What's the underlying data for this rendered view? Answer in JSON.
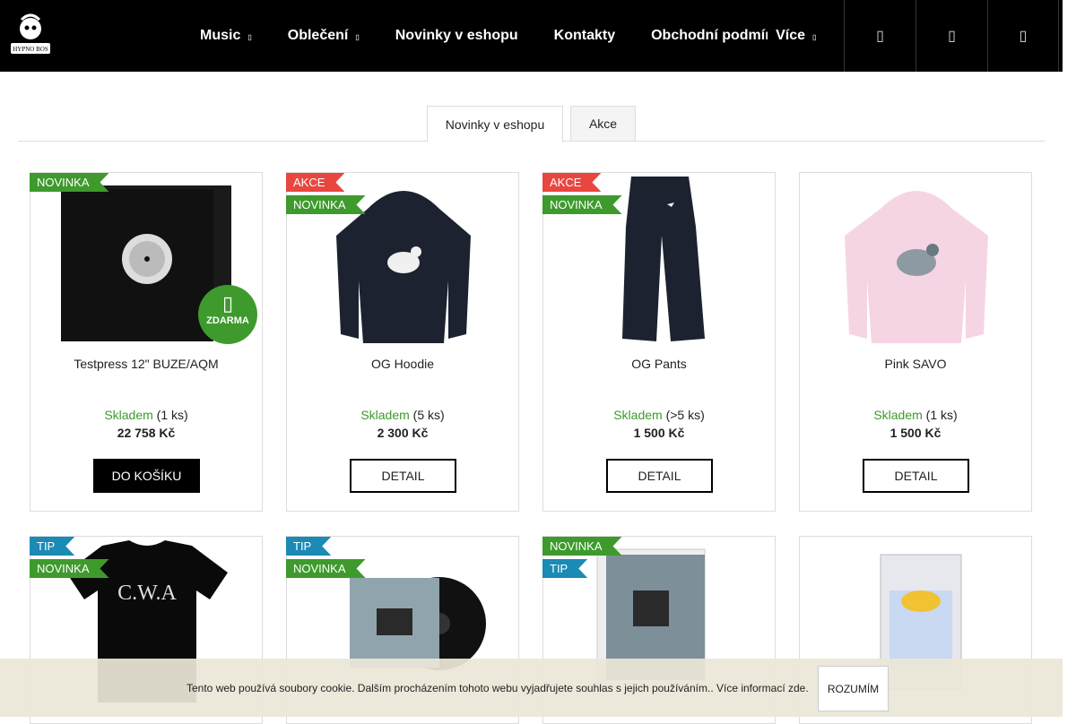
{
  "header": {
    "logo_text": "HYPNO BOS",
    "nav": [
      {
        "label": "Music",
        "has_dropdown": true
      },
      {
        "label": "Oblečení",
        "has_dropdown": true
      },
      {
        "label": "Novinky v eshopu",
        "has_dropdown": false
      },
      {
        "label": "Kontakty",
        "has_dropdown": false
      },
      {
        "label": "Obchodní podmínky",
        "has_dropdown": false
      },
      {
        "label": "Více",
        "has_dropdown": true
      }
    ],
    "icons": [
      "search-icon",
      "user-icon",
      "cart-icon"
    ]
  },
  "tabs": [
    {
      "label": "Novinky v eshopu",
      "active": true
    },
    {
      "label": "Akce",
      "active": false
    }
  ],
  "products": [
    {
      "name": "Testpress 12\" BUZE/AQM",
      "flags": [
        "NOVINKA"
      ],
      "stock_label": "Skladem",
      "stock_qty": "(1 ks)",
      "price": "22 758 Kč",
      "button": "DO KOŠÍKU",
      "free_shipping": "ZDARMA"
    },
    {
      "name": "OG Hoodie",
      "flags": [
        "AKCE",
        "NOVINKA"
      ],
      "stock_label": "Skladem",
      "stock_qty": "(5 ks)",
      "price": "2 300 Kč",
      "button": "DETAIL"
    },
    {
      "name": "OG Pants",
      "flags": [
        "AKCE",
        "NOVINKA"
      ],
      "stock_label": "Skladem",
      "stock_qty": "(>5 ks)",
      "price": "1 500 Kč",
      "button": "DETAIL"
    },
    {
      "name": "Pink SAVO",
      "flags": [],
      "stock_label": "Skladem",
      "stock_qty": "(1 ks)",
      "price": "1 500 Kč",
      "button": "DETAIL"
    },
    {
      "name": "",
      "flags": [
        "TIP",
        "NOVINKA"
      ]
    },
    {
      "name": "",
      "flags": [
        "TIP",
        "NOVINKA"
      ]
    },
    {
      "name": "",
      "flags": [
        "NOVINKA",
        "TIP"
      ]
    },
    {
      "name": "",
      "flags": []
    }
  ],
  "cookie": {
    "text": "Tento web používá soubory cookie. Dalším procházením tohoto webu vyjadřujete souhlas s jejich používáním.. Více informací zde.",
    "button": "ROZUMÍM"
  },
  "colors": {
    "new": "#3e9a2d",
    "sale": "#e8473f",
    "tip": "#1b8ab5",
    "header": "#000000"
  }
}
